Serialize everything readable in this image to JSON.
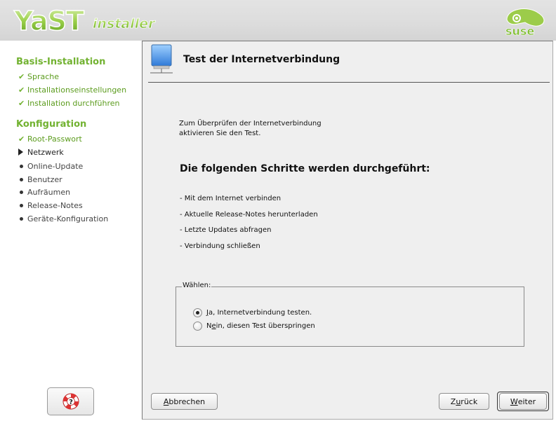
{
  "header": {
    "logo_text": "YaST installer",
    "brand_logo_text": "suse"
  },
  "sidebar": {
    "sections": [
      {
        "title": "Basis-Installation",
        "items": [
          {
            "label": "Sprache",
            "state": "done"
          },
          {
            "label": "Installationseinstellungen",
            "state": "done"
          },
          {
            "label": "Installation durchführen",
            "state": "done"
          }
        ]
      },
      {
        "title": "Konfiguration",
        "items": [
          {
            "label": "Root-Passwort",
            "state": "done"
          },
          {
            "label": "Netzwerk",
            "state": "current"
          },
          {
            "label": "Online-Update",
            "state": "pending"
          },
          {
            "label": "Benutzer",
            "state": "pending"
          },
          {
            "label": "Aufräumen",
            "state": "pending"
          },
          {
            "label": "Release-Notes",
            "state": "pending"
          },
          {
            "label": "Geräte-Konfiguration",
            "state": "pending"
          }
        ]
      }
    ],
    "help_icon": "help-lifebuoy-icon"
  },
  "dialog": {
    "title": "Test der Internetverbindung",
    "title_icon": "network-computer-icon",
    "intro_line1": "Zum Überprüfen der Internetverbindung",
    "intro_line2": "aktivieren Sie den Test.",
    "steps_heading": "Die folgenden Schritte werden durchgeführt:",
    "steps": [
      "- Mit dem Internet verbinden",
      "- Aktuelle Release-Notes herunterladen",
      "- Letzte Updates abfragen",
      "- Verbindung schließen"
    ],
    "choice": {
      "legend": "Wählen:",
      "options": [
        {
          "accel": "J",
          "rest": "a, Internetverbindung testen.",
          "checked": true
        },
        {
          "prefix": "N",
          "accel": "e",
          "rest": "in, diesen Test überspringen",
          "checked": false
        }
      ]
    }
  },
  "buttons": {
    "abort": {
      "accel": "A",
      "rest": "bbrechen"
    },
    "back": {
      "prefix": "Z",
      "accel": "u",
      "rest": "rück"
    },
    "next": {
      "accel": "W",
      "rest": "eiter"
    }
  },
  "colors": {
    "accent_green": "#72b231",
    "panel_bg": "#efefef",
    "header_bg": "#dcdcdc"
  }
}
